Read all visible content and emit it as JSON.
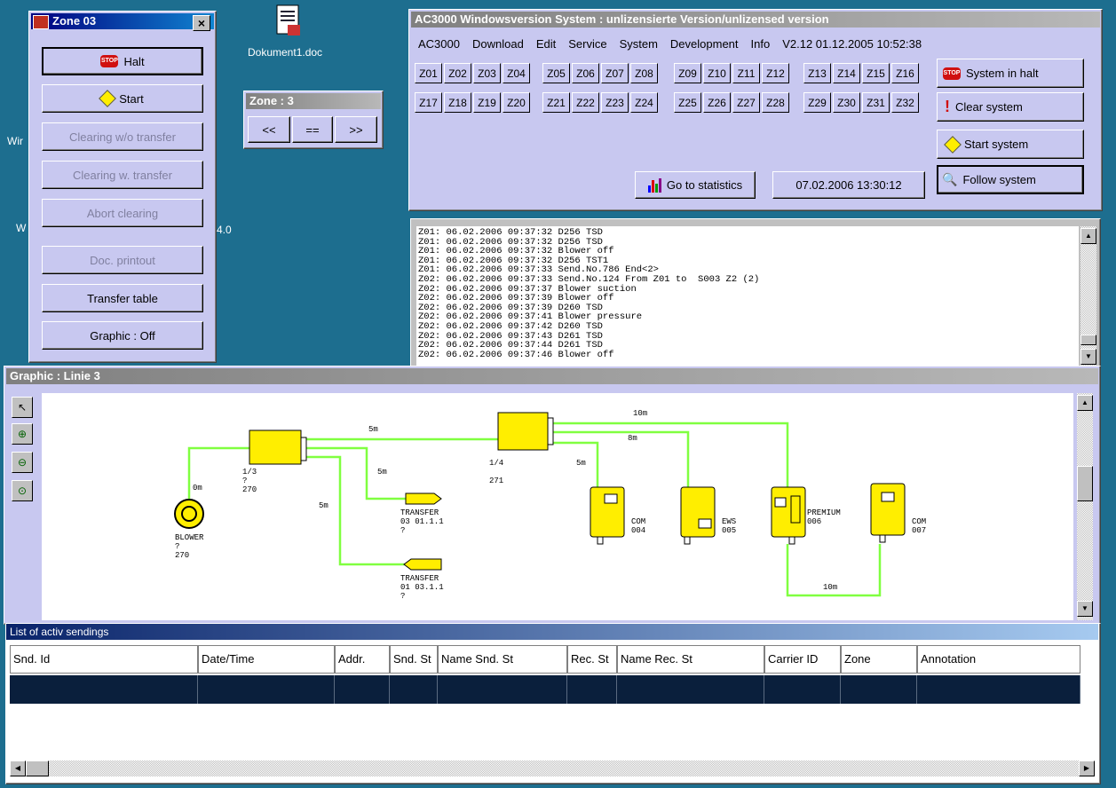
{
  "desktop": {
    "icons": [
      {
        "label": "Dokument1.doc"
      }
    ],
    "fragments": [
      "Wir",
      "W",
      "4.0"
    ]
  },
  "zone_panel": {
    "title": "Zone 03",
    "buttons": [
      {
        "label": "Halt",
        "enabled": true
      },
      {
        "label": "Start",
        "enabled": true
      },
      {
        "label": "Clearing w/o transfer",
        "enabled": false
      },
      {
        "label": "Clearing w. transfer",
        "enabled": false
      },
      {
        "label": "Abort clearing",
        "enabled": false
      },
      {
        "label": "Doc. printout",
        "enabled": false
      },
      {
        "label": "Transfer table",
        "enabled": true
      },
      {
        "label": "Graphic : Off",
        "enabled": true
      }
    ]
  },
  "zone_nav": {
    "title": "Zone : 3",
    "prev": "<<",
    "eq": "==",
    "next": ">>"
  },
  "main_window": {
    "title": "AC3000 Windowsversion System :  unlizensierte Version/unlizensed version",
    "menu": [
      "AC3000",
      "Download",
      "Edit",
      "Service",
      "System",
      "Development",
      "Info",
      "V2.12 01.12.2005 10:52:38"
    ],
    "zones_row1": [
      "Z01",
      "Z02",
      "Z03",
      "Z04",
      "Z05",
      "Z06",
      "Z07",
      "Z08",
      "Z09",
      "Z10",
      "Z11",
      "Z12",
      "Z13",
      "Z14",
      "Z15",
      "Z16"
    ],
    "zones_row2": [
      "Z17",
      "Z18",
      "Z19",
      "Z20",
      "Z21",
      "Z22",
      "Z23",
      "Z24",
      "Z25",
      "Z26",
      "Z27",
      "Z28",
      "Z29",
      "Z30",
      "Z31",
      "Z32"
    ],
    "system_halt": "System in halt",
    "clear_system": "Clear system",
    "start_system": "Start system",
    "follow_system": "Follow system",
    "go_stats": "Go to statistics",
    "datetime": "07.02.2006 13:30:12"
  },
  "log": {
    "lines": [
      "Z01: 06.02.2006 09:37:32 D256 TSD",
      "Z01: 06.02.2006 09:37:32 D256 TSD",
      "Z01: 06.02.2006 09:37:32 Blower off",
      "Z01: 06.02.2006 09:37:32 D256 TST1",
      "Z01: 06.02.2006 09:37:33 Send.No.786 End<2>",
      "Z02: 06.02.2006 09:37:33 Send.No.124 From Z01 to  S003 Z2 (2)",
      "Z02: 06.02.2006 09:37:37 Blower suction",
      "Z02: 06.02.2006 09:37:39 Blower off",
      "Z02: 06.02.2006 09:37:39 D260 TSD",
      "Z02: 06.02.2006 09:37:41 Blower pressure",
      "Z02: 06.02.2006 09:37:42 D260 TSD",
      "Z02: 06.02.2006 09:37:43 D261 TSD",
      "Z02: 06.02.2006 09:37:44 D261 TSD",
      "Z02: 06.02.2006 09:37:46 Blower off"
    ]
  },
  "graphic": {
    "title": "Graphic : Linie 3",
    "labels": {
      "blower": "BLOWER\n?\n270",
      "blower_len": "0m",
      "d1": "1/3\n?\n270",
      "d2": "1/4\n\n271",
      "transfer1": "TRANSFER\n03 01.1.1\n?",
      "transfer2": "TRANSFER\n01 03.1.1\n?",
      "st1": "COM\n004",
      "st2": "EWS\n005",
      "st3": "PREMIUM\n006",
      "st4": "COM\n007",
      "len_5m_a": "5m",
      "len_5m_b": "5m",
      "len_5m_c": "5m",
      "len_5m_d": "5m",
      "len_10m_a": "10m",
      "len_8m": "8m",
      "len_10m_b": "10m"
    }
  },
  "sendings": {
    "title": "List of activ sendings",
    "columns": [
      "Snd. Id",
      "Date/Time",
      "Addr.",
      "Snd. St",
      "Name Snd. St",
      "Rec. St",
      "Name Rec. St",
      "Carrier ID",
      "Zone",
      "Annotation"
    ]
  },
  "colors": {
    "desktop": "#1d6e8f",
    "panel": "#c8c8f0",
    "pipe": "#80ff40",
    "device": "#ffee00"
  }
}
